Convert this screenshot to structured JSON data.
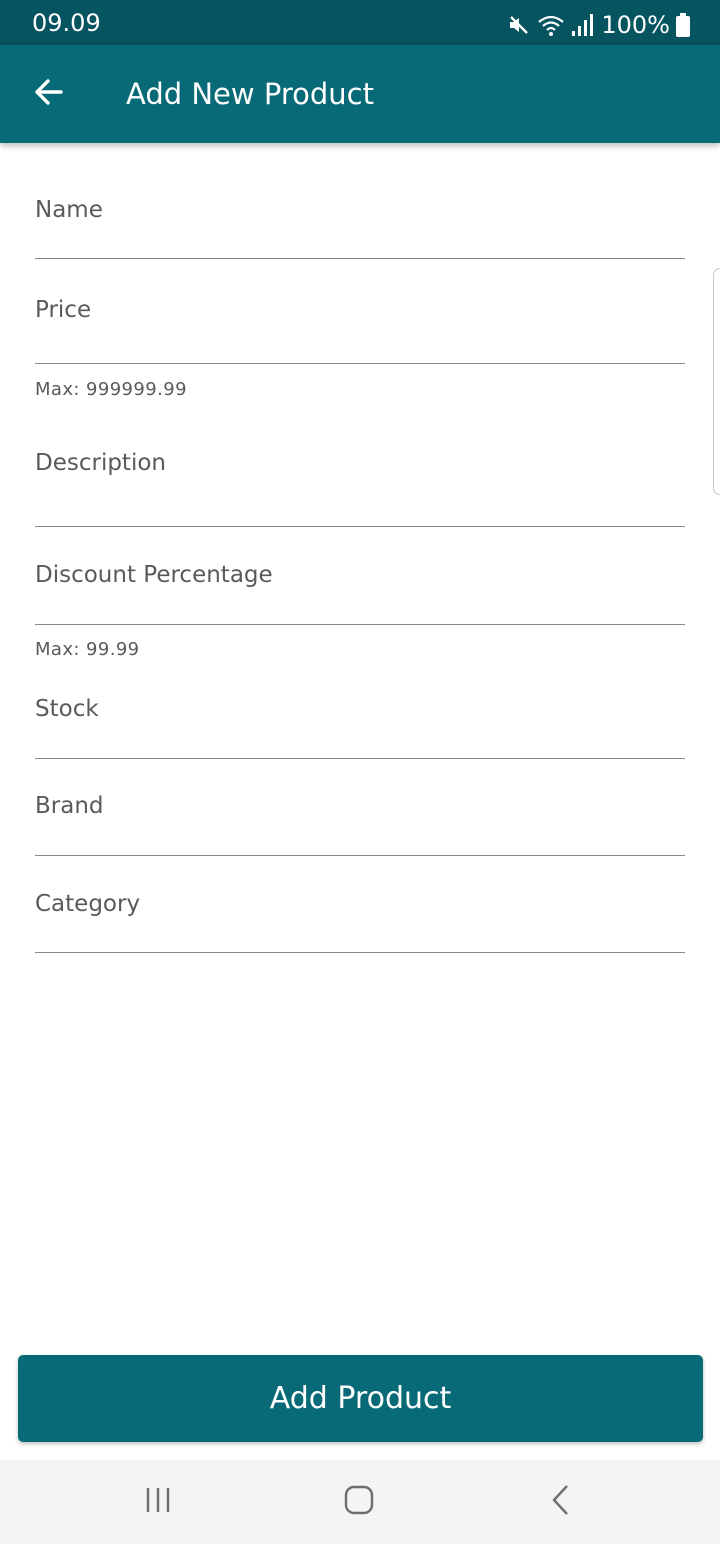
{
  "status_bar": {
    "time": "09.09",
    "battery": "100%",
    "icons": [
      "mute-icon",
      "wifi-icon",
      "signal-icon",
      "battery-icon"
    ]
  },
  "app_bar": {
    "title": "Add New Product",
    "back_icon": "arrow-left-icon"
  },
  "form": {
    "fields": [
      {
        "label": "Name",
        "value": ""
      },
      {
        "label": "Price",
        "value": "",
        "helper": "Max: 999999.99"
      },
      {
        "label": "Description",
        "value": ""
      },
      {
        "label": "Discount Percentage",
        "value": "",
        "helper": "Max: 99.99"
      },
      {
        "label": "Stock",
        "value": ""
      },
      {
        "label": "Brand",
        "value": ""
      },
      {
        "label": "Category",
        "value": ""
      }
    ]
  },
  "actions": {
    "add_product_label": "Add Product"
  },
  "nav_bar": {
    "buttons": [
      "recent-apps-icon",
      "home-icon",
      "back-icon"
    ]
  },
  "colors": {
    "status_bar": "#06545f",
    "primary": "#086a76",
    "underline": "#8a8a8a",
    "label_text": "#5a5a5a",
    "nav_background": "#f4f4f4"
  }
}
